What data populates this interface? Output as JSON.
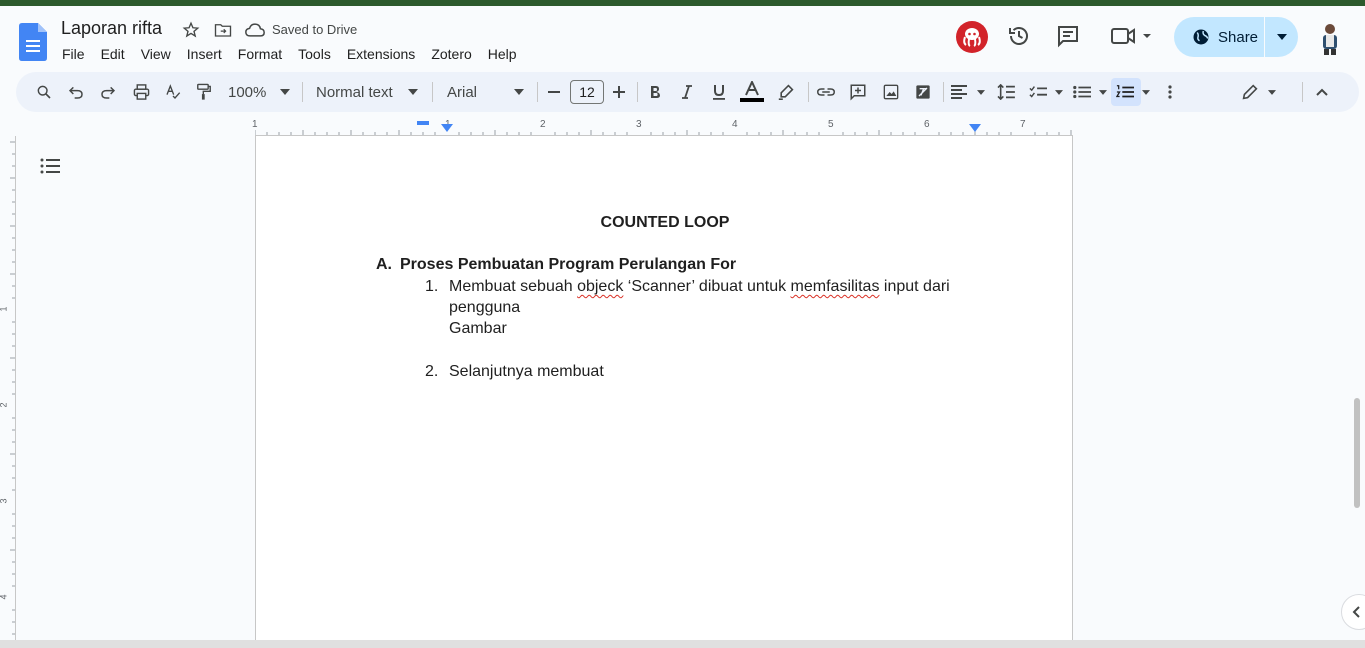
{
  "header": {
    "title": "Laporan rifta",
    "saved_status": "Saved to Drive",
    "menu": [
      "File",
      "Edit",
      "View",
      "Insert",
      "Format",
      "Tools",
      "Extensions",
      "Zotero",
      "Help"
    ],
    "share_label": "Share"
  },
  "toolbar": {
    "zoom": "100%",
    "style": "Normal text",
    "font": "Arial",
    "font_size": "12"
  },
  "ruler": {
    "numbers": [
      "1",
      "1",
      "2",
      "3",
      "4",
      "5",
      "6",
      "7"
    ],
    "vertical_numbers": [
      "1",
      "2",
      "3",
      "4"
    ]
  },
  "document": {
    "title": "COUNTED LOOP",
    "heading_label": "A.",
    "heading_text": "Proses Pembuatan Program Perulangan For",
    "item1_num": "1.",
    "item1_a": "Membuat sebuah ",
    "item1_w1": "objeck",
    "item1_b": " ‘Scanner’ dibuat untuk ",
    "item1_w2": "memfasilitas",
    "item1_c": " input dari pengguna",
    "item1_extra": "Gambar",
    "item2_num": "2.",
    "item2_text": "Selanjutnya membuat"
  },
  "colors": {
    "accent": "#c2e7ff",
    "toolbar_bg": "#edf2fa",
    "docs_blue": "#4285f4",
    "spell_red": "#d93025"
  }
}
